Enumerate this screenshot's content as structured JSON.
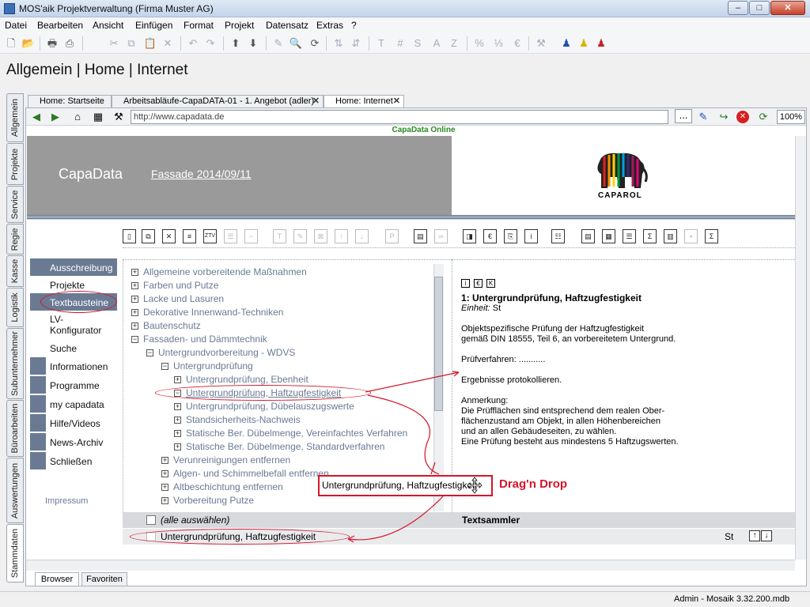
{
  "window": {
    "title": "MOS'aik Projektverwaltung (Firma Muster AG)",
    "min": "–",
    "max": "□",
    "close": "✕"
  },
  "menu": [
    "Datei",
    "Bearbeiten",
    "Ansicht",
    "Einfügen",
    "Format",
    "Projekt",
    "Datensatz",
    "Extras",
    "?"
  ],
  "module_heading": "Allgemein | Home | Internet",
  "vertical_tabs": [
    "Allgemein",
    "Projekte",
    "Service",
    "Regie",
    "Kasse",
    "Logistik",
    "Subunternehmer",
    "Büroarbeiten",
    "Auswertungen",
    "Stammdaten"
  ],
  "doc_tabs": [
    {
      "label": "Home: Startseite"
    },
    {
      "label": "Arbeitsabläufe-CapaDATA-01 - 1. Angebot (adler)",
      "close": "✕"
    },
    {
      "label": "Home: Internet",
      "close": "✕"
    }
  ],
  "browser": {
    "url": "http://www.capadata.de",
    "more": "...",
    "zoom": "100%"
  },
  "site": {
    "caption": "CapaData Online",
    "brand": "CapaData",
    "catalog": "Fassade 2014/09/11",
    "logo_text": "CAPAROL"
  },
  "left_nav": [
    "Ausschreibung",
    "Projekte",
    "Textbausteine",
    "LV-",
    "Konfigurator",
    "Suche",
    "Informationen",
    "Programme",
    "my capadata",
    "Hilfe/Videos",
    "News-Archiv",
    "Schließen"
  ],
  "impressum": "Impressum",
  "tree": [
    {
      "sign": "+",
      "text": "Allgemeine vorbereitende Maßnahmen"
    },
    {
      "sign": "+",
      "text": "Farben und Putze"
    },
    {
      "sign": "+",
      "text": "Lacke und Lasuren"
    },
    {
      "sign": "+",
      "text": "Dekorative Innenwand-Techniken"
    },
    {
      "sign": "+",
      "text": "Bautenschutz"
    },
    {
      "sign": "−",
      "text": "Fassaden- und Dämmtechnik"
    },
    {
      "sign": "−",
      "text": "Untergrundvorbereitung - WDVS"
    },
    {
      "sign": "−",
      "text": "Untergrundprüfung"
    },
    {
      "sign": "+",
      "text": "Untergrundprüfung, Ebenheit"
    },
    {
      "sign": "−",
      "text": "Untergrundprüfung, Haftzugfestigkeit"
    },
    {
      "sign": "+",
      "text": "Untergrundprüfung, Dübelauszugswerte"
    },
    {
      "sign": "+",
      "text": "Standsicherheits-Nachweis"
    },
    {
      "sign": "+",
      "text": "Statische Ber. Dübelmenge, Vereinfachtes Verfahren"
    },
    {
      "sign": "+",
      "text": "Statische Ber. Dübelmenge, Standardverfahren"
    },
    {
      "sign": "+",
      "text": "Verunreinigungen entfernen"
    },
    {
      "sign": "+",
      "text": "Algen- und Schimmelbefall entfernen"
    },
    {
      "sign": "+",
      "text": "Altbeschichtung entfernen"
    },
    {
      "sign": "+",
      "text": "Vorbereitung Putze"
    }
  ],
  "detail": {
    "icons": [
      "i",
      "€",
      "K"
    ],
    "title": "1: Untergrundprüfung, Haftzugfestigkeit",
    "unit_label": "Einheit:",
    "unit_value": "St",
    "lines": [
      "Objektspezifische Prüfung der Haftzugfestigkeit",
      "gemäß DIN 18555, Teil 6, an vorbereitetem Untergrund.",
      "",
      "Prüfverfahren: ...........",
      "",
      "Ergebnisse protokollieren.",
      "",
      "Anmerkung:",
      "Die Prüfflächen sind entsprechend dem realen Ober-",
      "flächenzustand am Objekt, in allen Höhenbereichen",
      "und an allen Gebäudeseiten, zu wählen.",
      "Eine Prüfung besteht aus mindestens 5 Haftzugswerten."
    ]
  },
  "sammler": {
    "select_all": "(alle auswählen)",
    "title": "Textsammler",
    "item": "Untergrundprüfung, Haftzugfestigkeit",
    "unit": "St",
    "up": "↑",
    "down": "↓"
  },
  "drag": {
    "box_text": "Untergrundprüfung, Haftzugfestigkeit",
    "label": "Drag'n Drop"
  },
  "bottom_tabs": [
    "Browser",
    "Favoriten"
  ],
  "status": "Admin - Mosaik 3.32.200.mdb",
  "colors": {
    "accent_red": "#d4162a",
    "nav_blue": "#6a7a93",
    "online_green": "#2a8a22"
  }
}
